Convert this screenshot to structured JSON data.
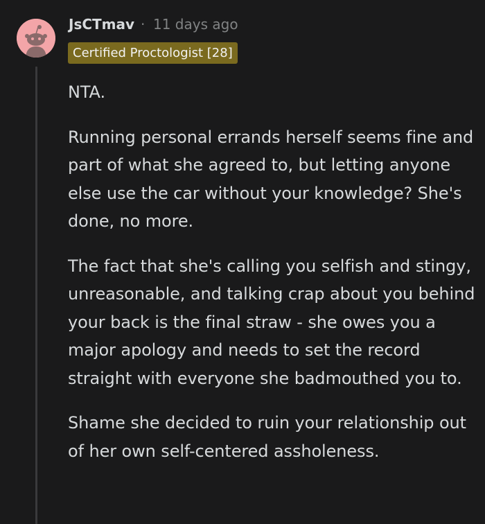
{
  "comment": {
    "username": "JsCTmav",
    "separator": "·",
    "timestamp": "11 days ago",
    "flair": "Certified Proctologist [28]",
    "paragraphs": [
      "NTA.",
      "Running personal errands herself seems fine and part of what she agreed to, but letting anyone else use the car without your knowledge? She's done, no more.",
      "The fact that she's calling you selfish and stingy, unreasonable, and talking crap about you behind your back is the final straw - she owes you a major apology and needs to set the record straight with everyone she badmouthed you to.",
      "Shame she decided to ruin your relationship out of her own self-centered assholeness."
    ]
  },
  "colors": {
    "background": "#1a1a1b",
    "text": "#d7dadc",
    "meta": "#818384",
    "flair_bg": "#7a6a1f",
    "avatar_bg": "#f3a5a8",
    "thread_line": "#3a3a3c"
  },
  "icons": {
    "avatar": "snoo-avatar-icon"
  }
}
